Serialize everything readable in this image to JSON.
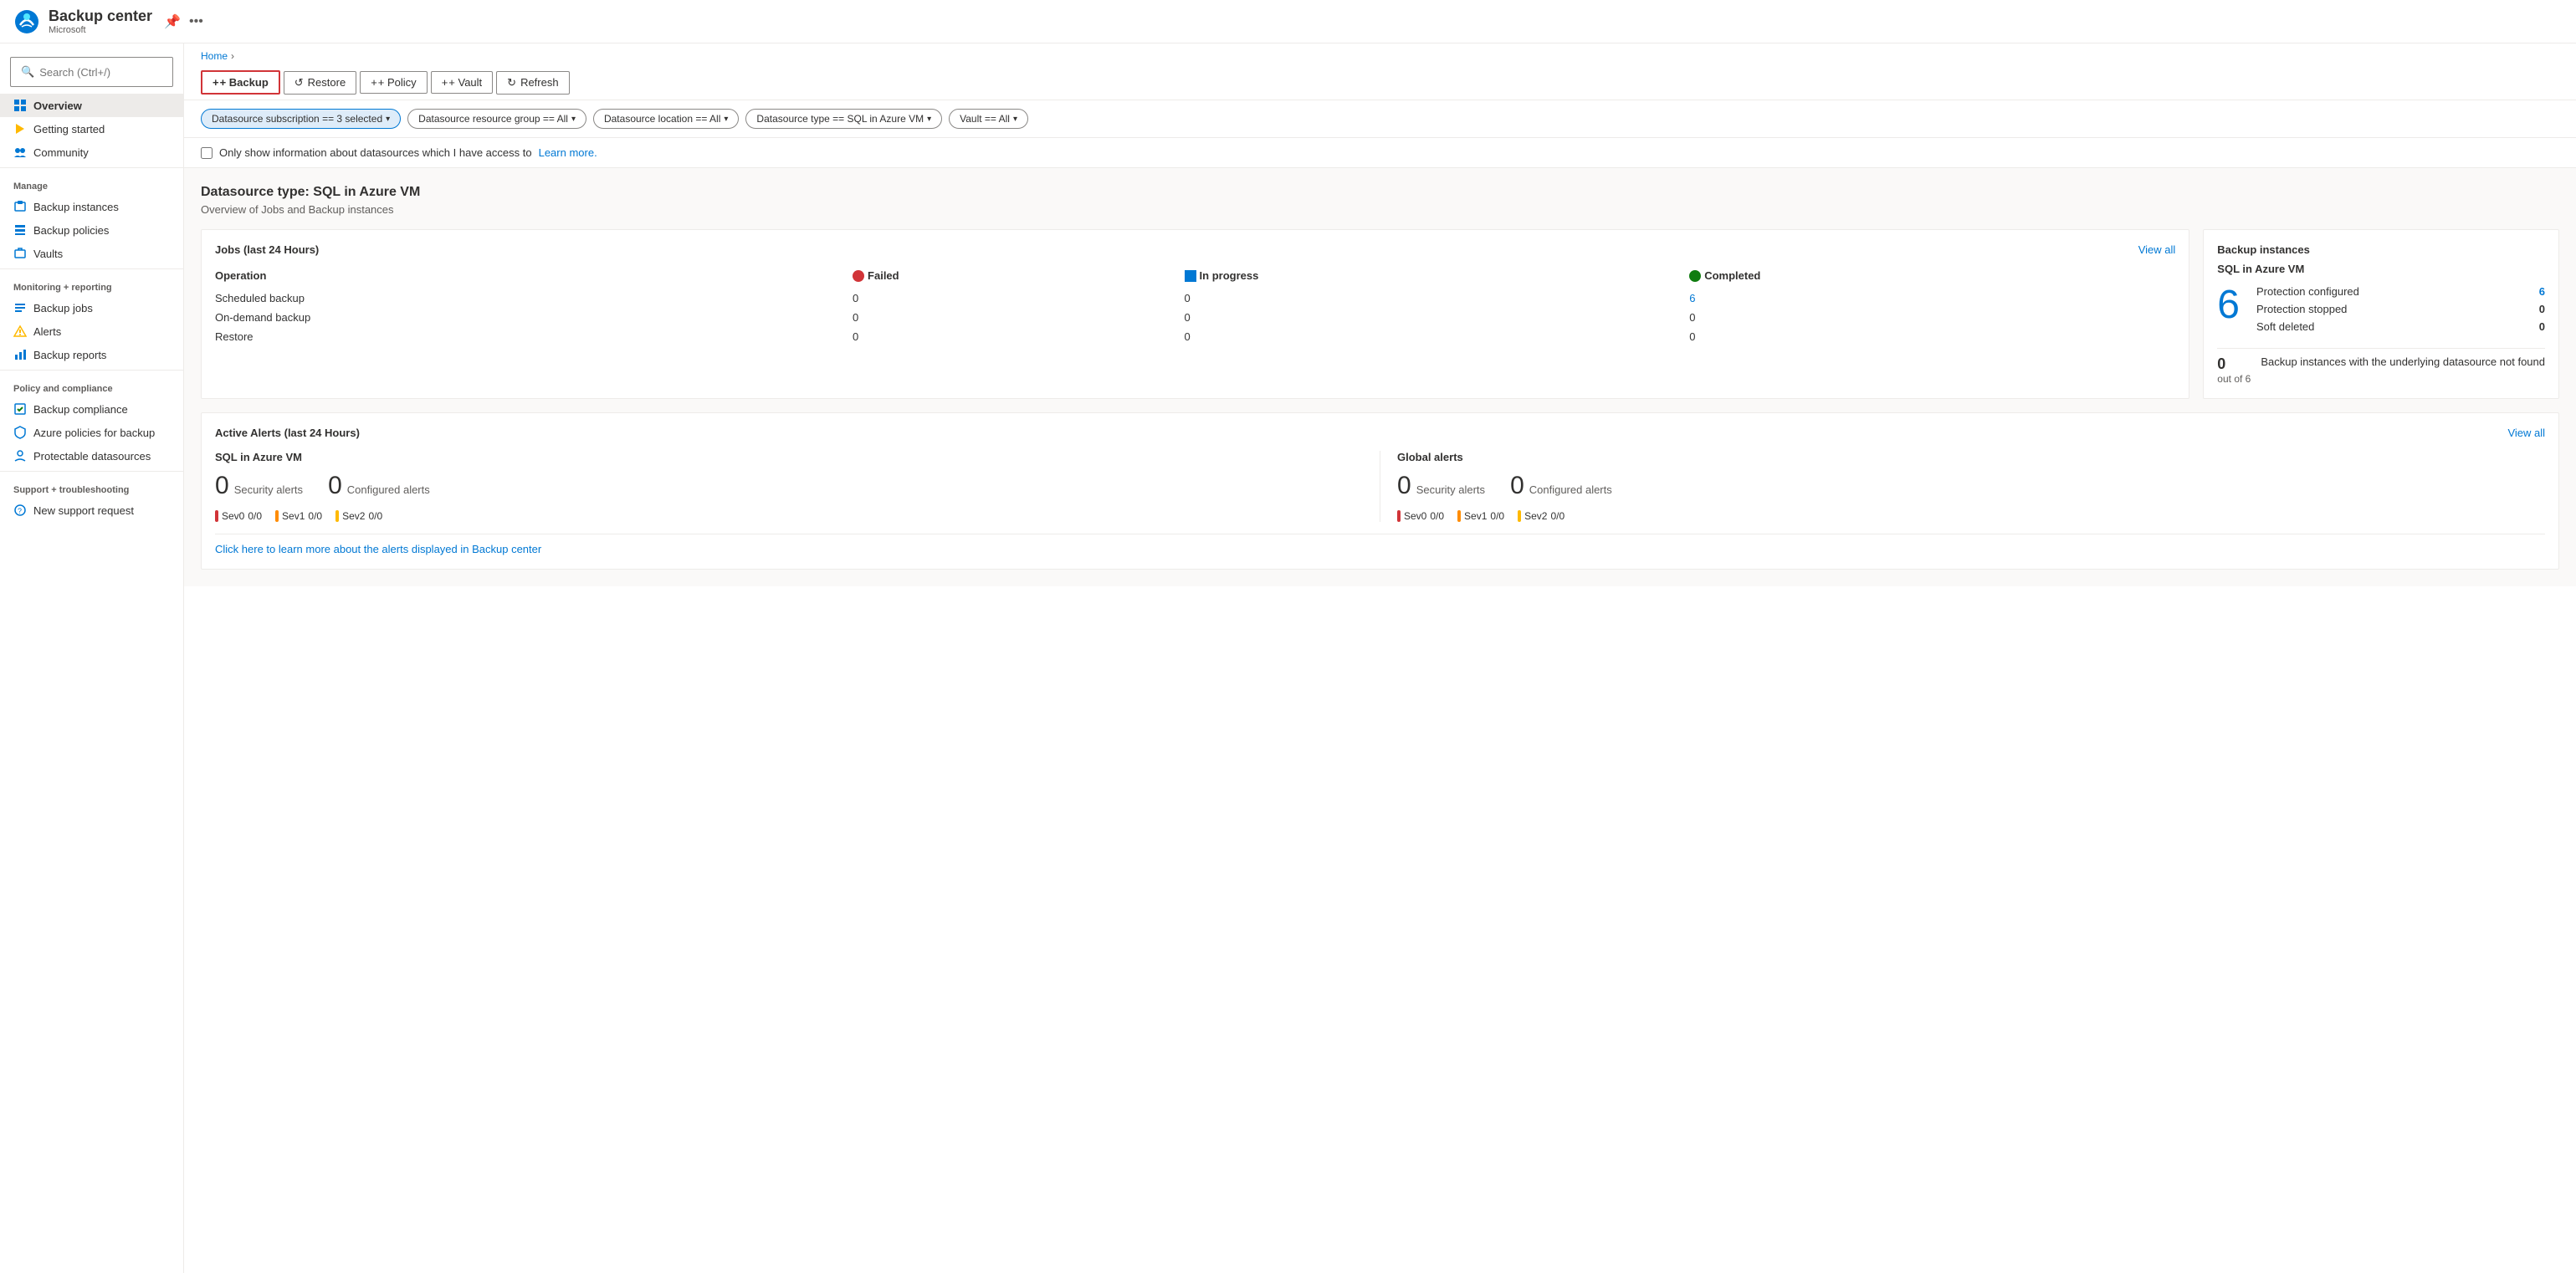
{
  "app": {
    "title": "Backup center",
    "subtitle": "Microsoft",
    "breadcrumb_home": "Home"
  },
  "toolbar": {
    "backup_label": "+ Backup",
    "restore_label": "Restore",
    "policy_label": "+ Policy",
    "vault_label": "+ Vault",
    "refresh_label": "Refresh"
  },
  "filters": [
    {
      "label": "Datasource subscription == 3 selected",
      "active": true
    },
    {
      "label": "Datasource resource group == All",
      "active": false
    },
    {
      "label": "Datasource location == All",
      "active": false
    },
    {
      "label": "Datasource type == SQL in Azure VM",
      "active": false
    },
    {
      "label": "Vault == All",
      "active": false
    }
  ],
  "checkbox_row": {
    "label": "Only show information about datasources which I have access to",
    "learn_more": "Learn more."
  },
  "datasource": {
    "title": "Datasource type: SQL in Azure VM",
    "subtitle": "Overview of Jobs and Backup instances"
  },
  "jobs_card": {
    "title": "Jobs (last 24 Hours)",
    "view_all": "View all",
    "columns": {
      "operation": "Operation",
      "failed": "Failed",
      "in_progress": "In progress",
      "completed": "Completed"
    },
    "rows": [
      {
        "operation": "Scheduled backup",
        "failed": "0",
        "in_progress": "0",
        "completed": "6"
      },
      {
        "operation": "On-demand backup",
        "failed": "0",
        "in_progress": "0",
        "completed": "0"
      },
      {
        "operation": "Restore",
        "failed": "0",
        "in_progress": "0",
        "completed": "0"
      }
    ]
  },
  "backup_instances_card": {
    "title": "Backup instances",
    "subtitle": "SQL in Azure VM",
    "total_count": "6",
    "protection_configured_label": "Protection configured",
    "protection_configured_value": "6",
    "protection_stopped_label": "Protection stopped",
    "protection_stopped_value": "0",
    "soft_deleted_label": "Soft deleted",
    "soft_deleted_value": "0",
    "not_found_count": "0",
    "not_found_out_of": "out of 6",
    "not_found_label": "Backup instances with the underlying datasource not found"
  },
  "alerts_card": {
    "title": "Active Alerts (last 24 Hours)",
    "view_all": "View all",
    "sql_section": {
      "title": "SQL in Azure VM",
      "security_count": "0",
      "security_label": "Security alerts",
      "configured_count": "0",
      "configured_label": "Configured alerts",
      "severities": [
        {
          "label": "Sev0",
          "value": "0/0",
          "color_class": "sev0"
        },
        {
          "label": "Sev1",
          "value": "0/0",
          "color_class": "sev1"
        },
        {
          "label": "Sev2",
          "value": "0/0",
          "color_class": "sev2"
        }
      ]
    },
    "global_section": {
      "title": "Global alerts",
      "security_count": "0",
      "security_label": "Security alerts",
      "configured_count": "0",
      "configured_label": "Configured alerts",
      "severities": [
        {
          "label": "Sev0",
          "value": "0/0",
          "color_class": "sev0"
        },
        {
          "label": "Sev1",
          "value": "0/0",
          "color_class": "sev1"
        },
        {
          "label": "Sev2",
          "value": "0/0",
          "color_class": "sev2"
        }
      ]
    },
    "learn_more": "Click here to learn more about the alerts displayed in Backup center"
  },
  "sidebar": {
    "search_placeholder": "Search (Ctrl+/)",
    "nav_items": [
      {
        "id": "overview",
        "label": "Overview",
        "active": true,
        "section": ""
      },
      {
        "id": "getting-started",
        "label": "Getting started",
        "active": false,
        "section": ""
      },
      {
        "id": "community",
        "label": "Community",
        "active": false,
        "section": ""
      },
      {
        "id": "backup-instances",
        "label": "Backup instances",
        "active": false,
        "section": "Manage"
      },
      {
        "id": "backup-policies",
        "label": "Backup policies",
        "active": false,
        "section": ""
      },
      {
        "id": "vaults",
        "label": "Vaults",
        "active": false,
        "section": ""
      },
      {
        "id": "backup-jobs",
        "label": "Backup jobs",
        "active": false,
        "section": "Monitoring + reporting"
      },
      {
        "id": "alerts",
        "label": "Alerts",
        "active": false,
        "section": ""
      },
      {
        "id": "backup-reports",
        "label": "Backup reports",
        "active": false,
        "section": ""
      },
      {
        "id": "backup-compliance",
        "label": "Backup compliance",
        "active": false,
        "section": "Policy and compliance"
      },
      {
        "id": "azure-policies",
        "label": "Azure policies for backup",
        "active": false,
        "section": ""
      },
      {
        "id": "protectable-datasources",
        "label": "Protectable datasources",
        "active": false,
        "section": ""
      },
      {
        "id": "new-support",
        "label": "New support request",
        "active": false,
        "section": "Support + troubleshooting"
      }
    ]
  }
}
